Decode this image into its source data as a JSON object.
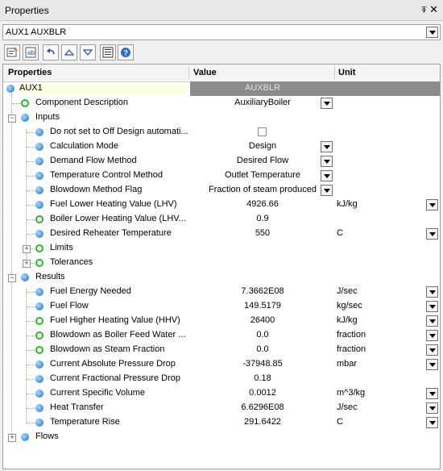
{
  "title": "Properties",
  "pin_glyph": "⍕",
  "close_glyph": "✕",
  "object_selector": "AUX1  AUXBLR",
  "toolbar_icons": [
    "properties-icon",
    "categorized-icon",
    "undo-icon",
    "move-up-icon",
    "move-down-icon",
    "property-pages-icon",
    "help-icon"
  ],
  "columns": {
    "properties": "Properties",
    "value": "Value",
    "unit": "Unit"
  },
  "root": {
    "name": "AUX1",
    "value": "AUXBLR"
  },
  "component_description": {
    "name": "Component Description",
    "value": "AuxiliaryBoiler"
  },
  "groups": {
    "inputs": "Inputs",
    "results": "Results",
    "flows": "Flows"
  },
  "inputs": [
    {
      "name": "Do not set to Off Design automati...",
      "value": "",
      "unit": "",
      "checkbox": true
    },
    {
      "name": "Calculation Mode",
      "value": "Design",
      "unit": "",
      "dd": true
    },
    {
      "name": "Demand Flow Method",
      "value": "Desired Flow",
      "unit": "",
      "dd": true
    },
    {
      "name": "Temperature Control Method",
      "value": "Outlet Temperature",
      "unit": "",
      "dd": true
    },
    {
      "name": "Blowdown Method Flag",
      "value": "Fraction of steam produced",
      "unit": "",
      "dd": true
    },
    {
      "name": "Fuel Lower Heating Value (LHV)",
      "value": "4926.66",
      "unit": "kJ/kg",
      "udd": true
    },
    {
      "name": "Boiler Lower Heating Value (LHV...",
      "value": "0.9",
      "unit": "",
      "ring": true
    },
    {
      "name": "Desired Reheater Temperature",
      "value": "550",
      "unit": "C",
      "udd": true
    },
    {
      "name": "Limits",
      "value": "",
      "unit": "",
      "sub": true,
      "ring": true
    },
    {
      "name": "Tolerances",
      "value": "",
      "unit": "",
      "sub": true,
      "ring": true
    }
  ],
  "results": [
    {
      "name": "Fuel Energy Needed",
      "value": "7.3662E08",
      "unit": "J/sec",
      "udd": true
    },
    {
      "name": "Fuel Flow",
      "value": "149.5179",
      "unit": "kg/sec",
      "udd": true
    },
    {
      "name": "Fuel Higher Heating Value (HHV)",
      "value": "26400",
      "unit": "kJ/kg",
      "udd": true,
      "ring": true
    },
    {
      "name": "Blowdown as Boiler Feed Water ...",
      "value": "0.0",
      "unit": "fraction",
      "udd": true,
      "ring": true
    },
    {
      "name": "Blowdown as Steam Fraction",
      "value": "0.0",
      "unit": "fraction",
      "udd": true,
      "ring": true
    },
    {
      "name": "Current Absolute Pressure Drop",
      "value": "-37948.85",
      "unit": "mbar",
      "udd": true
    },
    {
      "name": "Current Fractional Pressure Drop",
      "value": "0.18",
      "unit": ""
    },
    {
      "name": "Current Specific Volume",
      "value": "0.0012",
      "unit": "m^3/kg",
      "udd": true
    },
    {
      "name": "Heat Transfer",
      "value": "6.6296E08",
      "unit": "J/sec",
      "udd": true
    },
    {
      "name": "Temperature Rise",
      "value": "291.6422",
      "unit": "C",
      "udd": true
    }
  ]
}
